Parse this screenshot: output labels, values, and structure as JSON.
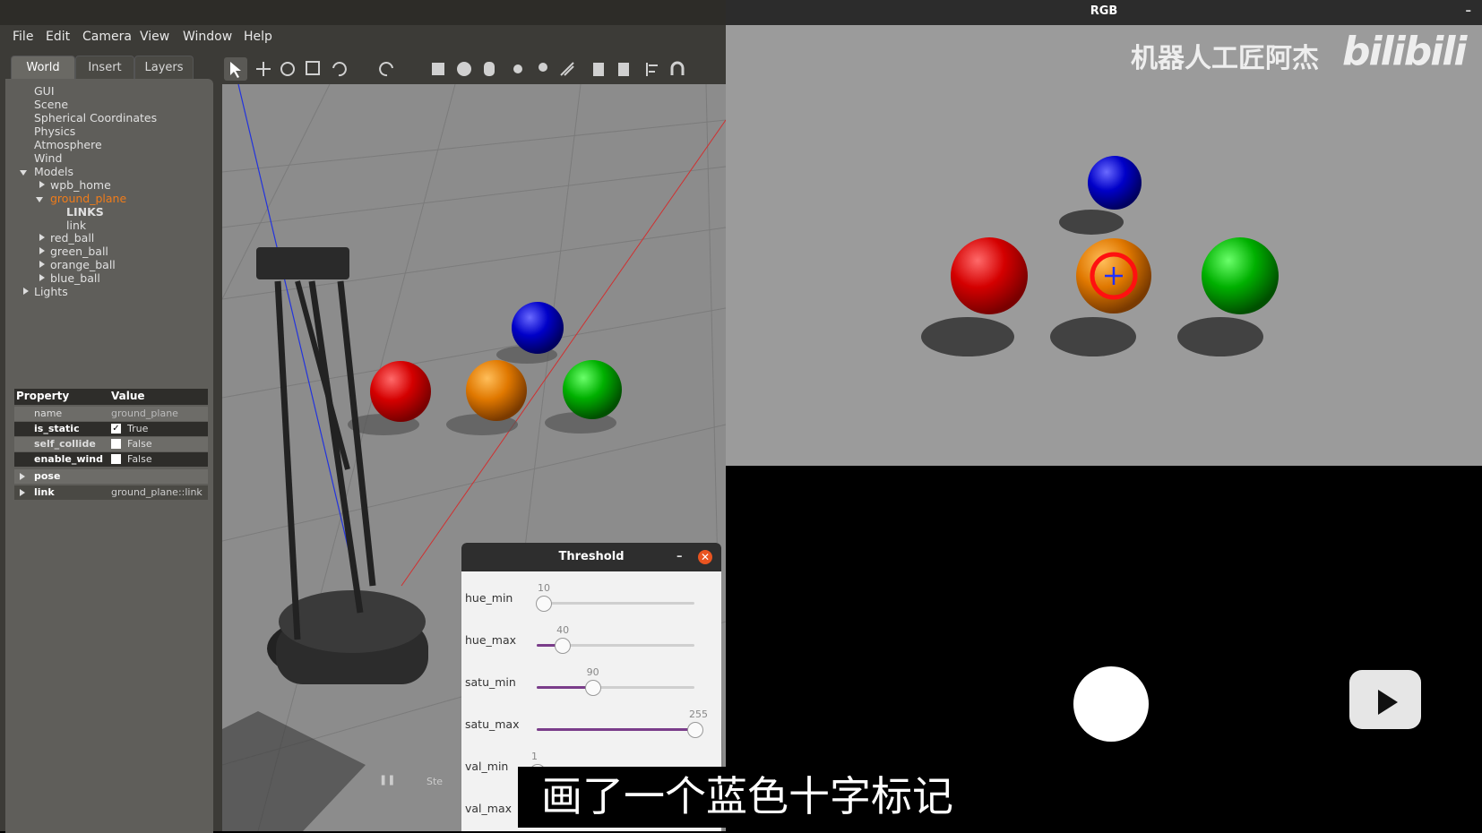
{
  "gazebo": {
    "menu": [
      "File",
      "Edit",
      "Camera",
      "View",
      "Window",
      "Help"
    ],
    "tabs": [
      "World",
      "Insert",
      "Layers"
    ],
    "tree": {
      "gui": "GUI",
      "scene": "Scene",
      "spherical": "Spherical Coordinates",
      "physics": "Physics",
      "atmosphere": "Atmosphere",
      "wind": "Wind",
      "models": "Models",
      "wpb_home": "wpb_home",
      "ground_plane": "ground_plane",
      "links": "LINKS",
      "link": "link",
      "red_ball": "red_ball",
      "green_ball": "green_ball",
      "orange_ball": "orange_ball",
      "blue_ball": "blue_ball",
      "lights": "Lights"
    },
    "properties": {
      "header_property": "Property",
      "header_value": "Value",
      "name_key": "name",
      "name_val": "ground_plane",
      "is_static_key": "is_static",
      "is_static_val": "True",
      "self_collide_key": "self_collide",
      "self_collide_val": "False",
      "enable_wind_key": "enable_wind",
      "enable_wind_val": "False",
      "pose_key": "pose",
      "link_key": "link",
      "link_val": "ground_plane::link"
    },
    "status_step": "Ste"
  },
  "rgb": {
    "title": "RGB",
    "minimize": "–"
  },
  "threshold": {
    "title": "Threshold",
    "minimize": "–",
    "sliders": [
      {
        "label": "hue_min",
        "value": "10",
        "level": 0.04
      },
      {
        "label": "hue_max",
        "value": "40",
        "level": 0.16
      },
      {
        "label": "satu_min",
        "value": "90",
        "level": 0.35
      },
      {
        "label": "satu_max",
        "value": "255",
        "level": 1.0
      },
      {
        "label": "val_min",
        "value": "1",
        "level": 0.0
      },
      {
        "label": "val_max",
        "value": "",
        "level": 0.0
      }
    ]
  },
  "watermark": {
    "channel": "机器人工匠阿杰",
    "brand": "bilibili"
  },
  "subtitle": "画了一个蓝色十字标记",
  "colors": {
    "red_ball": "#d40000",
    "orange_ball": "#e07800",
    "green_ball": "#00b000",
    "blue_ball": "#0000c8",
    "slider_fill": "#7a3d8a",
    "selected_tree": "#f07c1a"
  }
}
